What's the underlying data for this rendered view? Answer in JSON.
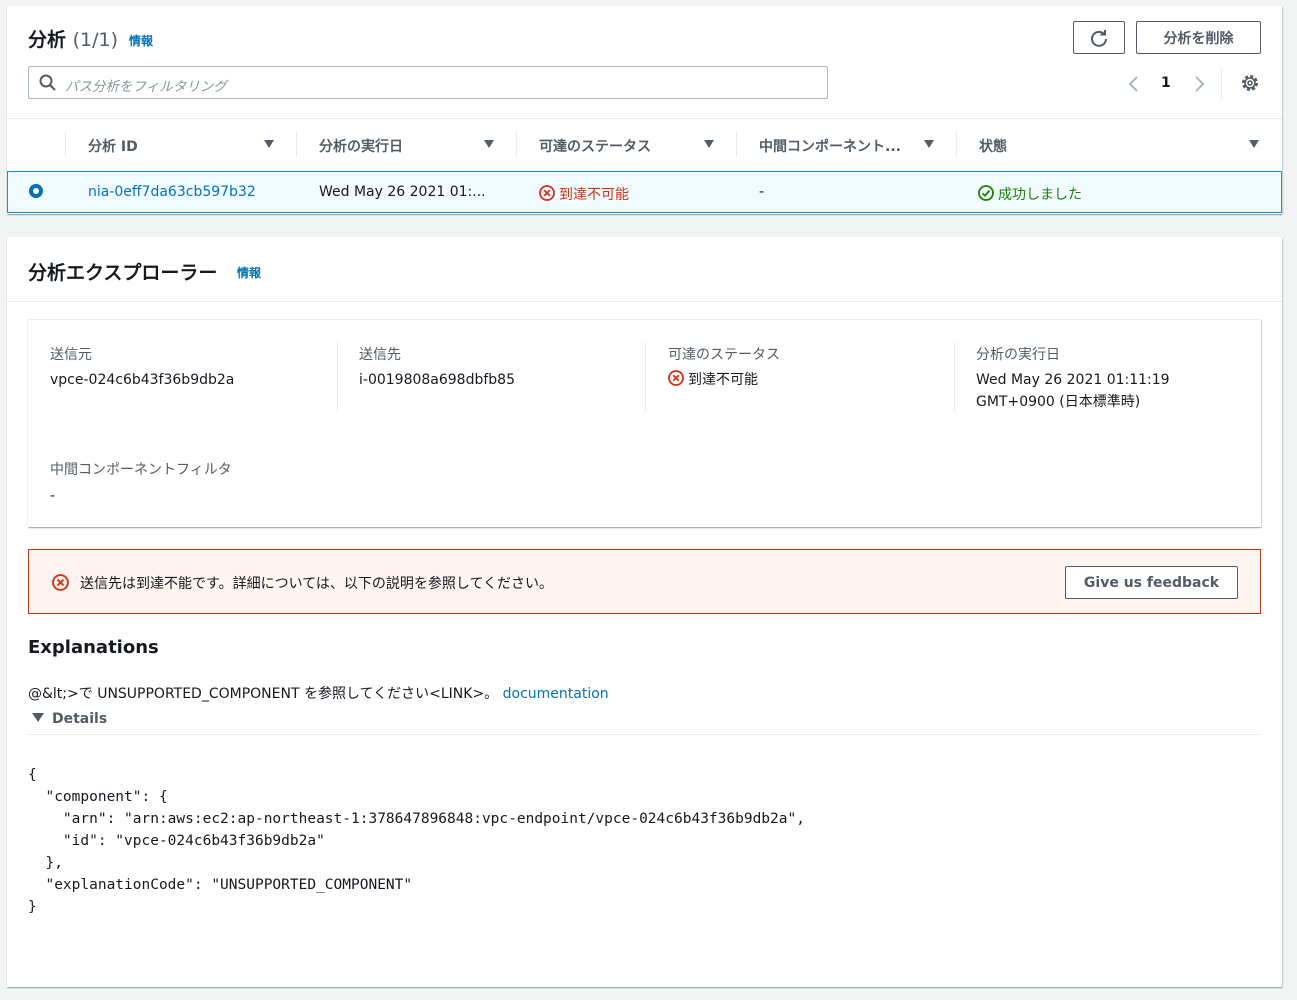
{
  "analyses_panel": {
    "title": "分析",
    "count": "(1/1)",
    "info_link": "情報",
    "delete_button": "分析を削除",
    "search_placeholder": "パス分析をフィルタリング",
    "page_number": "1",
    "columns": [
      "分析 ID",
      "分析の実行日",
      "可達のステータス",
      "中間コンポーネント...",
      "状態"
    ],
    "rows": [
      {
        "analysis_id": "nia-0eff7da63cb597b32",
        "run_date": "Wed May 26 2021 01:...",
        "reachability": "到達不可能",
        "intermediate": "-",
        "state": "成功しました",
        "selected": true
      }
    ]
  },
  "explorer_panel": {
    "title": "分析エクスプローラー",
    "info_link": "情報",
    "fields": {
      "source_label": "送信元",
      "source_value": "vpce-024c6b43f36b9db2a",
      "destination_label": "送信先",
      "destination_value": "i-0019808a698dbfb85",
      "reachability_label": "可達のステータス",
      "reachability_value": "到達不可能",
      "run_date_label": "分析の実行日",
      "run_date_line1": "Wed May 26 2021 01:11:19",
      "run_date_line2": "GMT+0900 (日本標準時)",
      "intermediate_label": "中間コンポーネントフィルタ",
      "intermediate_value": "-"
    },
    "alert": {
      "message": "送信先は到達不能です。詳細については、以下の説明を参照してください。",
      "feedback_button": "Give us feedback"
    },
    "explanations": {
      "heading": "Explanations",
      "text": "@&lt;>で UNSUPPORTED_COMPONENT を参照してください<LINK>。",
      "link": "documentation",
      "details_label": "Details",
      "json": "{\n  \"component\": {\n    \"arn\": \"arn:aws:ec2:ap-northeast-1:378647896848:vpc-endpoint/vpce-024c6b43f36b9db2a\",\n    \"id\": \"vpce-024c6b43f36b9db2a\"\n  },\n  \"explanationCode\": \"UNSUPPORTED_COMPONENT\"\n}"
    }
  },
  "colors": {
    "link": "#0073bb",
    "error": "#d13212",
    "success": "#1d8102",
    "selected_row_bg": "#f1faff",
    "selected_row_border": "#00a1c9"
  },
  "icons": [
    "refresh-icon",
    "search-icon",
    "chevron-left-icon",
    "chevron-right-icon",
    "gear-icon",
    "error-circle-icon",
    "success-circle-icon",
    "caret-down-icon"
  ]
}
